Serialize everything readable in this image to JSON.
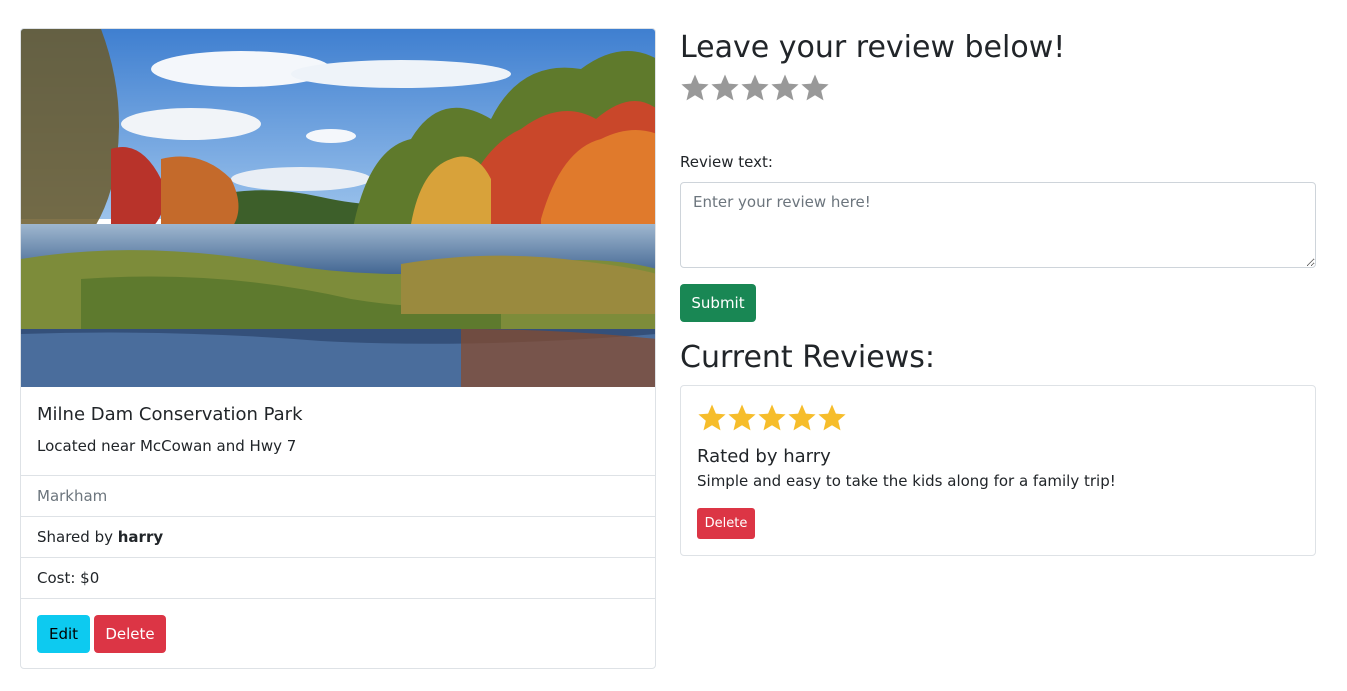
{
  "campground": {
    "title": "Milne Dam Conservation Park",
    "description": "Located near McCowan and Hwy 7",
    "location": "Markham",
    "shared_by_prefix": "Shared by ",
    "author": "harry",
    "cost": "Cost: $0",
    "edit_label": "Edit",
    "delete_label": "Delete"
  },
  "review_form": {
    "heading": "Leave your review below!",
    "rating": 0,
    "max_rating": 5,
    "star_empty_color": "#999999",
    "text_label": "Review text:",
    "placeholder": "Enter your review here!",
    "submit_label": "Submit"
  },
  "reviews": {
    "heading": "Current Reviews:",
    "star_color": "#f6bd2b",
    "items": [
      {
        "rating": 5,
        "rated_by": "Rated by harry",
        "body": "Simple and easy to take the kids along for a family trip!",
        "delete_label": "Delete"
      }
    ]
  },
  "colors": {
    "success": "#198754",
    "danger": "#dc3545",
    "info": "#0dcaf0"
  }
}
